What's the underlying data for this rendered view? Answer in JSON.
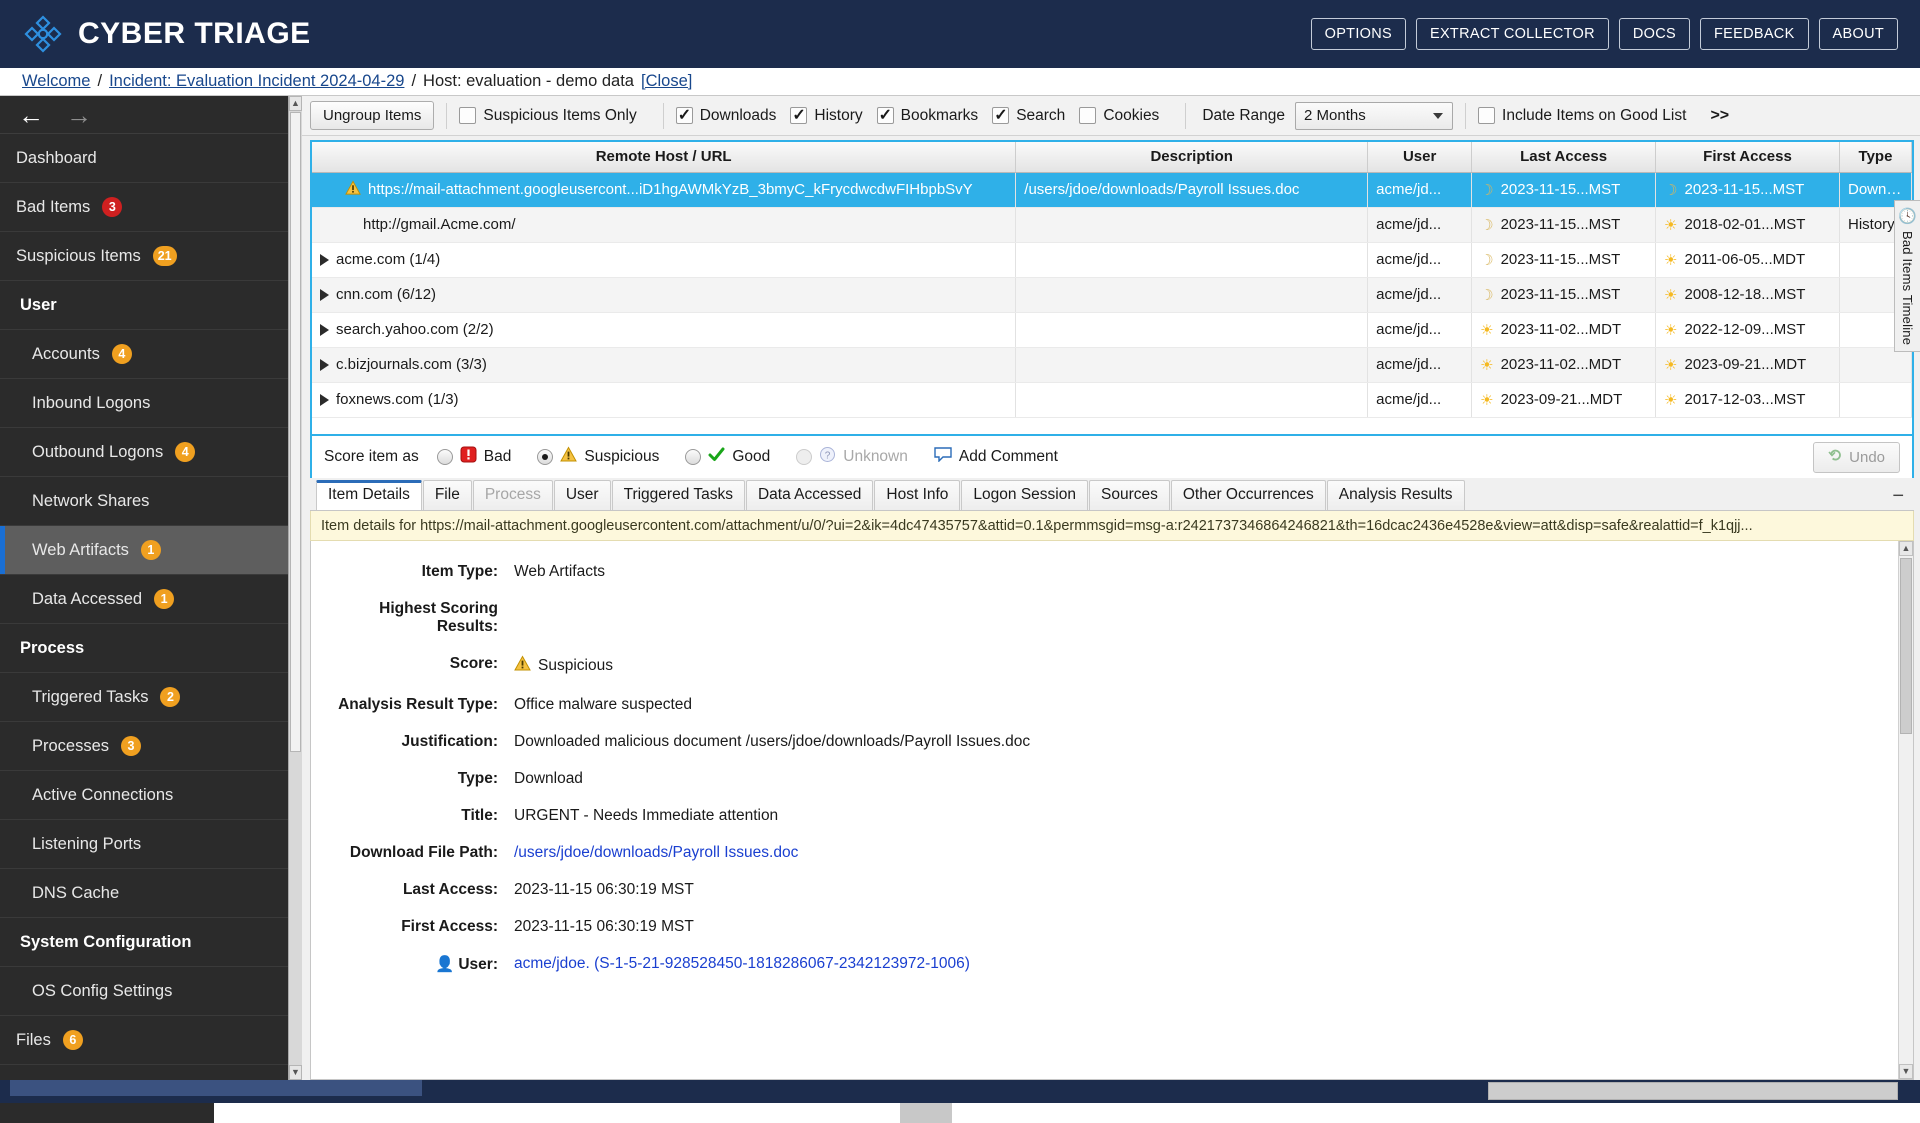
{
  "header": {
    "brand": "CYBER TRIAGE",
    "logo_icon": "cyber-triage-logo-icon",
    "buttons": [
      {
        "label": "OPTIONS",
        "name": "options-button"
      },
      {
        "label": "EXTRACT COLLECTOR",
        "name": "extract-collector-button"
      },
      {
        "label": "DOCS",
        "name": "docs-button"
      },
      {
        "label": "FEEDBACK",
        "name": "feedback-button"
      },
      {
        "label": "ABOUT",
        "name": "about-button"
      }
    ]
  },
  "breadcrumb": {
    "welcome": "Welcome",
    "sep1": "/",
    "incident": "Incident: Evaluation Incident 2024-04-29",
    "sep2": "/",
    "host": "Host: evaluation - demo data",
    "close": "[Close]"
  },
  "sidebar": {
    "back_icon": "arrow-left-icon",
    "forward_icon": "arrow-right-icon",
    "items": [
      {
        "label": "Dashboard",
        "badge": "",
        "badge_color": "",
        "type": "item",
        "selected": false
      },
      {
        "label": "Bad Items",
        "badge": "3",
        "badge_color": "red",
        "type": "item",
        "selected": false
      },
      {
        "label": "Suspicious Items",
        "badge": "21",
        "badge_color": "orange",
        "type": "item",
        "selected": false
      },
      {
        "label": "User",
        "badge": "",
        "badge_color": "",
        "type": "group",
        "selected": false
      },
      {
        "label": "Accounts",
        "badge": "4",
        "badge_color": "orange",
        "type": "sub",
        "selected": false
      },
      {
        "label": "Inbound Logons",
        "badge": "",
        "badge_color": "",
        "type": "sub",
        "selected": false
      },
      {
        "label": "Outbound Logons",
        "badge": "4",
        "badge_color": "orange",
        "type": "sub",
        "selected": false
      },
      {
        "label": "Network Shares",
        "badge": "",
        "badge_color": "",
        "type": "sub",
        "selected": false
      },
      {
        "label": "Web Artifacts",
        "badge": "1",
        "badge_color": "orange",
        "type": "sub",
        "selected": true
      },
      {
        "label": "Data Accessed",
        "badge": "1",
        "badge_color": "orange",
        "type": "sub",
        "selected": false
      },
      {
        "label": "Process",
        "badge": "",
        "badge_color": "",
        "type": "group",
        "selected": false
      },
      {
        "label": "Triggered Tasks",
        "badge": "2",
        "badge_color": "orange",
        "type": "sub",
        "selected": false
      },
      {
        "label": "Processes",
        "badge": "3",
        "badge_color": "orange",
        "type": "sub",
        "selected": false
      },
      {
        "label": "Active Connections",
        "badge": "",
        "badge_color": "",
        "type": "sub",
        "selected": false
      },
      {
        "label": "Listening Ports",
        "badge": "",
        "badge_color": "",
        "type": "sub",
        "selected": false
      },
      {
        "label": "DNS Cache",
        "badge": "",
        "badge_color": "",
        "type": "sub",
        "selected": false
      },
      {
        "label": "System Configuration",
        "badge": "",
        "badge_color": "",
        "type": "group",
        "selected": false
      },
      {
        "label": "OS Config Settings",
        "badge": "",
        "badge_color": "",
        "type": "sub",
        "selected": false
      },
      {
        "label": "Files",
        "badge": "6",
        "badge_color": "orange",
        "type": "item",
        "selected": false
      }
    ]
  },
  "toolbar": {
    "ungroup_label": "Ungroup Items",
    "checkboxes": [
      {
        "label": "Suspicious Items Only",
        "checked": false,
        "name": "suspicious-items-only-checkbox"
      },
      {
        "label": "Downloads",
        "checked": true,
        "name": "downloads-checkbox"
      },
      {
        "label": "History",
        "checked": true,
        "name": "history-checkbox"
      },
      {
        "label": "Bookmarks",
        "checked": true,
        "name": "bookmarks-checkbox"
      },
      {
        "label": "Search",
        "checked": true,
        "name": "search-checkbox"
      },
      {
        "label": "Cookies",
        "checked": false,
        "name": "cookies-checkbox"
      }
    ],
    "date_range_label": "Date Range",
    "date_range_value": "2 Months",
    "good_list_label": "Include Items on Good List",
    "good_list_checked": false,
    "more_label": ">>"
  },
  "table": {
    "columns": [
      "Remote Host / URL",
      "Description",
      "User",
      "Last Access",
      "First Access",
      "Type"
    ],
    "rows": [
      {
        "expandable": false,
        "warn": true,
        "selected": true,
        "url": "https://mail-attachment.googleusercont...iD1hgAWMkYzB_3bmyC_kFrycdwcdwFIHbpbSvY",
        "description": "/users/jdoe/downloads/Payroll Issues.doc",
        "user": "acme/jd...",
        "last_access": "2023-11-15...MST",
        "last_icon": "moon",
        "first_access": "2023-11-15...MST",
        "first_icon": "moon",
        "type": "Download"
      },
      {
        "expandable": false,
        "warn": false,
        "selected": false,
        "url": "http://gmail.Acme.com/",
        "description": "",
        "user": "acme/jd...",
        "last_access": "2023-11-15...MST",
        "last_icon": "moon",
        "first_access": "2018-02-01...MST",
        "first_icon": "sun",
        "type": "History"
      },
      {
        "expandable": true,
        "warn": false,
        "selected": false,
        "url": "acme.com (1/4)",
        "description": "",
        "user": "acme/jd...",
        "last_access": "2023-11-15...MST",
        "last_icon": "moon",
        "first_access": "2011-06-05...MDT",
        "first_icon": "sun",
        "type": ""
      },
      {
        "expandable": true,
        "warn": false,
        "selected": false,
        "url": "cnn.com (6/12)",
        "description": "",
        "user": "acme/jd...",
        "last_access": "2023-11-15...MST",
        "last_icon": "moon",
        "first_access": "2008-12-18...MST",
        "first_icon": "sun",
        "type": ""
      },
      {
        "expandable": true,
        "warn": false,
        "selected": false,
        "url": "search.yahoo.com (2/2)",
        "description": "",
        "user": "acme/jd...",
        "last_access": "2023-11-02...MDT",
        "last_icon": "sun",
        "first_access": "2022-12-09...MST",
        "first_icon": "sun",
        "type": ""
      },
      {
        "expandable": true,
        "warn": false,
        "selected": false,
        "url": "c.bizjournals.com (3/3)",
        "description": "",
        "user": "acme/jd...",
        "last_access": "2023-11-02...MDT",
        "last_icon": "sun",
        "first_access": "2023-09-21...MDT",
        "first_icon": "sun",
        "type": ""
      },
      {
        "expandable": true,
        "warn": false,
        "selected": false,
        "url": "foxnews.com (1/3)",
        "description": "",
        "user": "acme/jd...",
        "last_access": "2023-09-21...MDT",
        "last_icon": "sun",
        "first_access": "2017-12-03...MST",
        "first_icon": "sun",
        "type": ""
      }
    ]
  },
  "score_bar": {
    "label": "Score item as",
    "options": [
      {
        "label": "Bad",
        "selected": false,
        "icon": "bad-icon",
        "disabled": false
      },
      {
        "label": "Suspicious",
        "selected": true,
        "icon": "warning-icon",
        "disabled": false
      },
      {
        "label": "Good",
        "selected": false,
        "icon": "check-icon",
        "disabled": false
      },
      {
        "label": "Unknown",
        "selected": false,
        "icon": "question-icon",
        "disabled": true
      }
    ],
    "add_comment": "Add Comment",
    "undo": "Undo"
  },
  "tabs": [
    {
      "label": "Item Details",
      "active": true,
      "disabled": false
    },
    {
      "label": "File",
      "active": false,
      "disabled": false
    },
    {
      "label": "Process",
      "active": false,
      "disabled": true
    },
    {
      "label": "User",
      "active": false,
      "disabled": false
    },
    {
      "label": "Triggered Tasks",
      "active": false,
      "disabled": false
    },
    {
      "label": "Data Accessed",
      "active": false,
      "disabled": false
    },
    {
      "label": "Host Info",
      "active": false,
      "disabled": false
    },
    {
      "label": "Logon Session",
      "active": false,
      "disabled": false
    },
    {
      "label": "Sources",
      "active": false,
      "disabled": false
    },
    {
      "label": "Other Occurrences",
      "active": false,
      "disabled": false
    },
    {
      "label": "Analysis Results",
      "active": false,
      "disabled": false
    }
  ],
  "collapse_icon": "minimize-icon",
  "info_strip": "Item details for https://mail-attachment.googleusercontent.com/attachment/u/0/?ui=2&ik=4dc47435757&attid=0.1&permmsgid=msg-a:r2421737346864246821&th=16dcac2436e4528e&view=att&disp=safe&realattid=f_k1qjj...",
  "details": {
    "item_type_key": "Item Type:",
    "item_type_val": "Web Artifacts",
    "highest_key": "Highest Scoring Results:",
    "score_key": "Score:",
    "score_val": "Suspicious",
    "analysis_key": "Analysis Result Type:",
    "analysis_val": "Office malware suspected",
    "justification_key": "Justification:",
    "justification_val": "Downloaded malicious document /users/jdoe/downloads/Payroll Issues.doc",
    "type_key": "Type:",
    "type_val": "Download",
    "title_key": "Title:",
    "title_val": "URGENT - Needs Immediate attention",
    "path_key": "Download File Path:",
    "path_val": "/users/jdoe/downloads/Payroll Issues.doc",
    "last_key": "Last Access:",
    "last_val": "2023-11-15 06:30:19 MST",
    "first_key": "First Access:",
    "first_val": "2023-11-15 06:30:19 MST",
    "user_key": "User:",
    "user_val": "acme/jdoe. (S-1-5-21-928528450-1818286067-2342123972-1006)"
  },
  "timeline_tab": {
    "label": "Bad Items Timeline",
    "icon": "clock-icon"
  },
  "colors": {
    "brand_navy": "#1c2c4c",
    "selection_blue": "#2fb0e8",
    "badge_orange": "#f0a020",
    "badge_red": "#cf2020",
    "link_blue": "#1a3fd0"
  }
}
